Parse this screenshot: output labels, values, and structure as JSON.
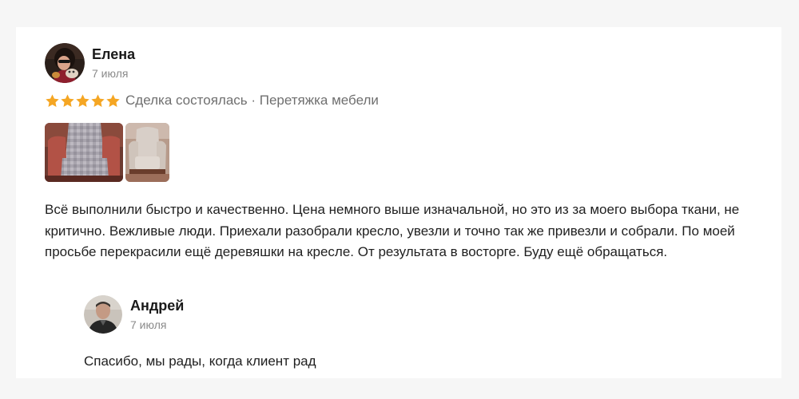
{
  "review": {
    "author": {
      "name": "Елена",
      "date": "7 июля",
      "avatar_icon": "user-avatar-elena"
    },
    "rating": 5,
    "star_color": "#f5a623",
    "deal_text": "Сделка состоялась · Перетяжка мебели",
    "photos": [
      {
        "name": "armchair-before-photo"
      },
      {
        "name": "armchair-after-photo"
      }
    ],
    "text": "Всё выполнили быстро и качественно. Цена немного выше изначальной, но это из за моего выбора ткани, не критично. Вежливые люди. Приехали разобрали кресло, увезли и точно так же привезли и собрали. По моей просьбе перекрасили ещё деревяшки на кресле. От результата в восторге. Буду ещё обращаться."
  },
  "reply": {
    "author": {
      "name": "Андрей",
      "date": "7 июля",
      "avatar_icon": "user-avatar-andrey"
    },
    "text": "Спасибо, мы рады, когда клиент рад"
  }
}
